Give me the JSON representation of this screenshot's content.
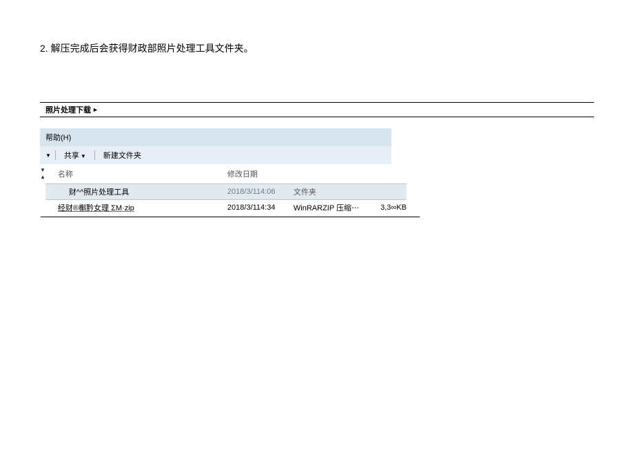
{
  "instruction": "2. 解压完成后会获得财政部照片处理工具文件夹。",
  "breadcrumb": {
    "label": "照片处理下载",
    "arrow": "►"
  },
  "menubar": {
    "help": "帮助(H)"
  },
  "toolbar": {
    "dropdown_icon": "▼",
    "share": "共享",
    "share_icon": "▼",
    "newfolder": "新建文件夹"
  },
  "sortcol": {
    "down": "▼",
    "up": "▲"
  },
  "columns": {
    "name": "名称",
    "date": "修改日期",
    "type": "",
    "size": ""
  },
  "rows": [
    {
      "name": "财^^照片处理工具",
      "date": "2018/3/114:06",
      "type": "文件夹",
      "size": ""
    },
    {
      "name": "经财®槲黔女理 ΣM·zip",
      "date": "2018/3/114:34",
      "type": "WinRARZIP 压缩⋯",
      "size": "3,3∞KB"
    }
  ]
}
